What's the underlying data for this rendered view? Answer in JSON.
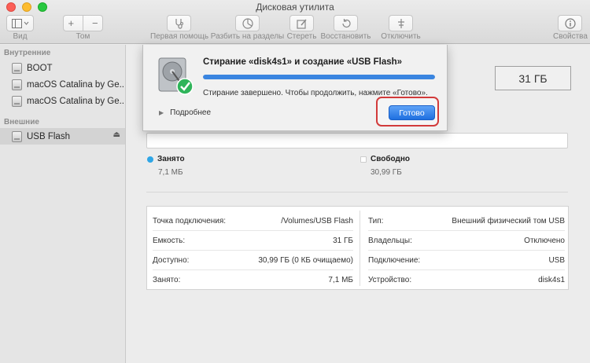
{
  "window": {
    "title": "Дисковая утилита"
  },
  "toolbar": {
    "view_label": "Вид",
    "volume_label": "Том",
    "first_aid_label": "Первая помощь",
    "partition_label": "Разбить на разделы",
    "erase_label": "Стереть",
    "restore_label": "Восстановить",
    "unmount_label": "Отключить",
    "info_label": "Свойства",
    "plus_glyph": "+",
    "minus_glyph": "−"
  },
  "sidebar": {
    "internal_header": "Внутренние",
    "external_header": "Внешние",
    "internal_items": [
      {
        "label": "BOOT"
      },
      {
        "label": "macOS Catalina by Ge..."
      },
      {
        "label": "macOS Catalina by Ge..."
      }
    ],
    "external_items": [
      {
        "label": "USB Flash"
      }
    ],
    "eject_glyph": "⏏"
  },
  "dialog": {
    "title": "Стирание «disk4s1» и создание «USB Flash»",
    "progress_fraction": 1.0,
    "status": "Стирание завершено. Чтобы продолжить, нажмите «Готово».",
    "details_label": "Подробнее",
    "done_label": "Готово"
  },
  "volume": {
    "capacity": "31 ГБ",
    "used_label": "Занято",
    "used_value": "7,1 МБ",
    "free_label": "Свободно",
    "free_value": "30,99 ГБ",
    "used_color": "#2fa6e6",
    "free_color": "#ffffff"
  },
  "info": {
    "left": [
      {
        "key": "Точка подключения:",
        "value": "/Volumes/USB Flash"
      },
      {
        "key": "Емкость:",
        "value": "31 ГБ"
      },
      {
        "key": "Доступно:",
        "value": "30,99 ГБ (0 КБ очищаемо)"
      },
      {
        "key": "Занято:",
        "value": "7,1 МБ"
      }
    ],
    "right": [
      {
        "key": "Тип:",
        "value": "Внешний физический том USB"
      },
      {
        "key": "Владельцы:",
        "value": "Отключено"
      },
      {
        "key": "Подключение:",
        "value": "USB"
      },
      {
        "key": "Устройство:",
        "value": "disk4s1"
      }
    ]
  }
}
